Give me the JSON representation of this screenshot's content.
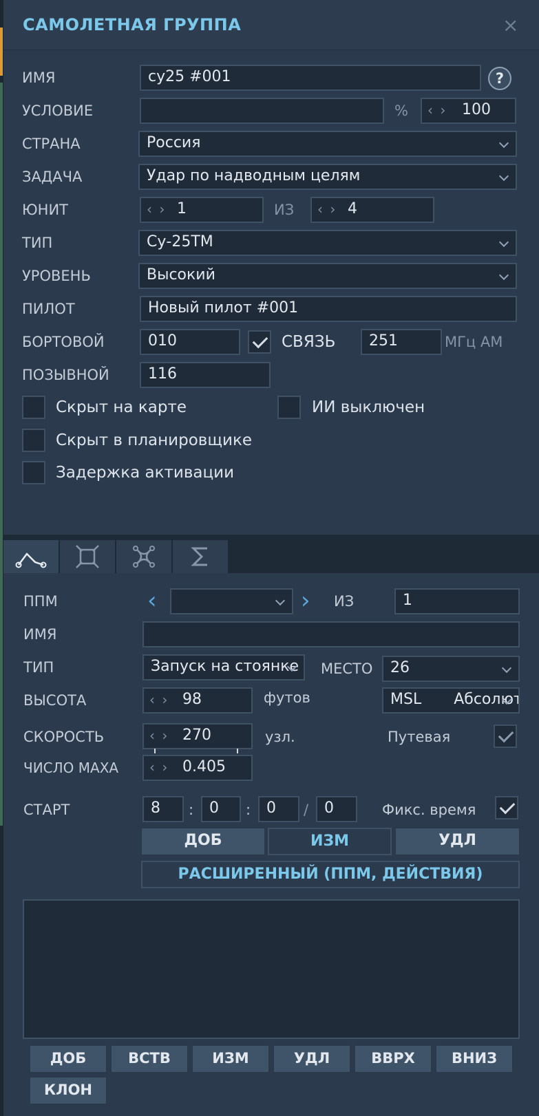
{
  "window": {
    "title": "САМОЛЕТНАЯ ГРУППА",
    "close": "×"
  },
  "group": {
    "name_label": "ИМЯ",
    "name_value": "су25 #001",
    "help": "?",
    "condition_label": "УСЛОВИЕ",
    "condition_value": "",
    "percent": "%",
    "percent_value": "100",
    "country_label": "СТРАНА",
    "country_value": "Россия",
    "task_label": "ЗАДАЧА",
    "task_value": "Удар по надводным целям",
    "unit_label": "ЮНИТ",
    "unit_value": "1",
    "of_label": "ИЗ",
    "unit_total": "4",
    "type_label": "ТИП",
    "type_value": "Су-25ТМ",
    "skill_label": "УРОВЕНЬ",
    "skill_value": "Высокий",
    "pilot_label": "ПИЛОТ",
    "pilot_value": "Новый пилот #001",
    "board_label": "БОРТОВОЙ",
    "board_value": "010",
    "radio_label": "СВЯЗЬ",
    "radio_value": "251",
    "radio_unit": "МГц АМ",
    "callsign_label": "ПОЗЫВНОЙ",
    "callsign_value": "116",
    "hidden_map": "Скрыт на карте",
    "ai_off": "ИИ выключен",
    "hidden_planner": "Скрыт в планировщике",
    "late_activation": "Задержка активации"
  },
  "waypoint": {
    "wp_label": "ППМ",
    "wp_value": "",
    "of_label": "ИЗ",
    "wp_total": "1",
    "name_label": "ИМЯ",
    "name_value": "",
    "type_label": "ТИП",
    "type_value": "Запуск на стоянке",
    "place_label": "МЕСТО",
    "place_value": "26",
    "alt_label": "ВЫСОТА",
    "alt_value": "98",
    "alt_unit": "футов",
    "alt_ref1": "MSL",
    "alt_ref2": "Абсолютная",
    "speed_label": "СКОРОСТЬ",
    "speed_value": "270",
    "speed_unit": "узл.",
    "track_label": "Путевая",
    "mach_label": "ЧИСЛО МАХА",
    "mach_value": "0.405",
    "start_label": "СТАРТ",
    "h": "8",
    "m": "0",
    "s": "0",
    "d": "0",
    "colon": ":",
    "slash": "/",
    "fixed_time": "Фикс. время",
    "add": "ДОБ",
    "edit": "ИЗМ",
    "del": "УДЛ",
    "advanced": "РАСШИРЕННЫЙ (ППМ, ДЕЙСТВИЯ)"
  },
  "list_buttons": [
    "ДОБ",
    "ВСТВ",
    "ИЗМ",
    "УДЛ",
    "ВВРХ",
    "ВНИЗ",
    "КЛОН"
  ]
}
